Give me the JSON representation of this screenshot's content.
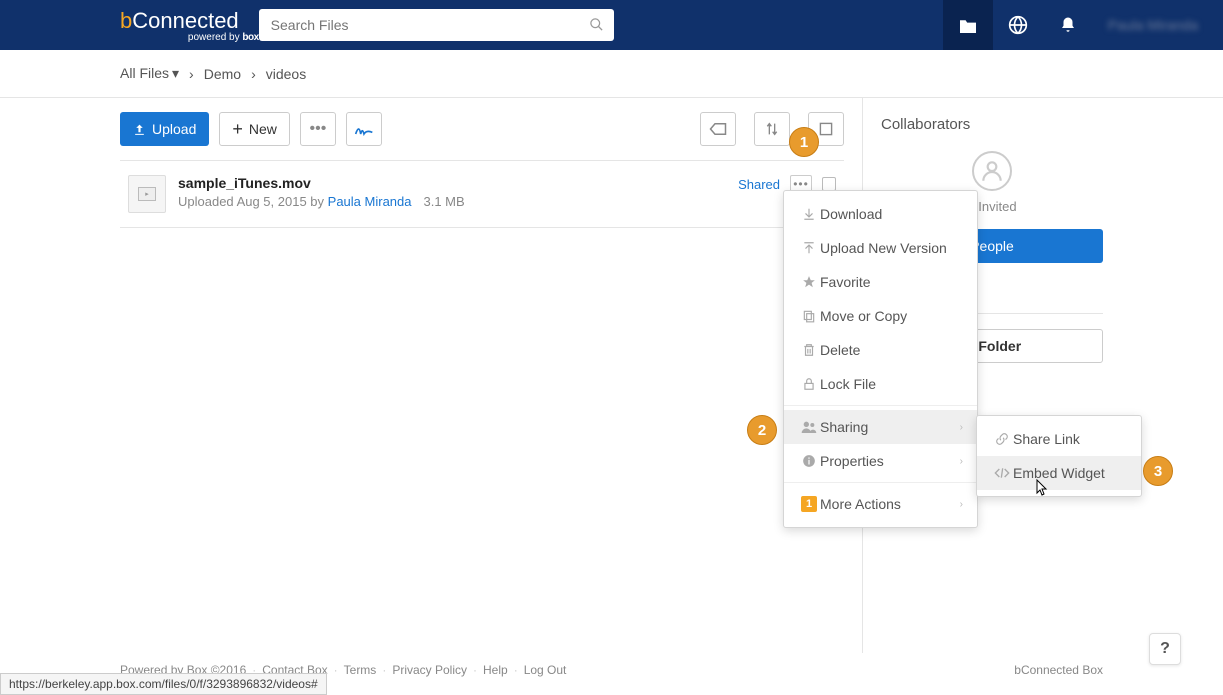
{
  "logo": {
    "prefix": "b",
    "text": "Connected",
    "sub_prefix": "powered by ",
    "sub_brand": "box"
  },
  "search": {
    "placeholder": "Search Files"
  },
  "topbar_user": "Paula Miranda",
  "breadcrumb": {
    "root": "All Files",
    "mid": "Demo",
    "current": "videos"
  },
  "toolbar": {
    "upload": "Upload",
    "new": "New"
  },
  "file": {
    "name": "sample_iTunes.mov",
    "uploaded_prefix": "Uploaded ",
    "date": "Aug 5, 2015",
    "by": " by ",
    "uploader": "Paula Miranda",
    "size": "3.1 MB",
    "shared": "Shared"
  },
  "sidebar": {
    "collaborators_heading": "Collaborators",
    "invited_text": "e Invited",
    "people_button": "People",
    "folder_button": "is Folder"
  },
  "menu": {
    "download": "Download",
    "upload_version": "Upload New Version",
    "favorite": "Favorite",
    "move_copy": "Move or Copy",
    "delete": "Delete",
    "lock": "Lock File",
    "sharing": "Sharing",
    "properties": "Properties",
    "more_actions": "More Actions",
    "badge_count": "1"
  },
  "submenu": {
    "share_link": "Share Link",
    "embed_widget": "Embed Widget"
  },
  "callouts": {
    "c1": "1",
    "c2": "2",
    "c3": "3"
  },
  "footer": {
    "powered": "Powered by Box ©2016",
    "contact": "Contact Box",
    "terms": "Terms",
    "privacy": "Privacy Policy",
    "help": "Help",
    "logout": "Log Out",
    "right": "bConnected Box"
  },
  "help_button": "?",
  "status_url": "https://berkeley.app.box.com/files/0/f/3293896832/videos#"
}
